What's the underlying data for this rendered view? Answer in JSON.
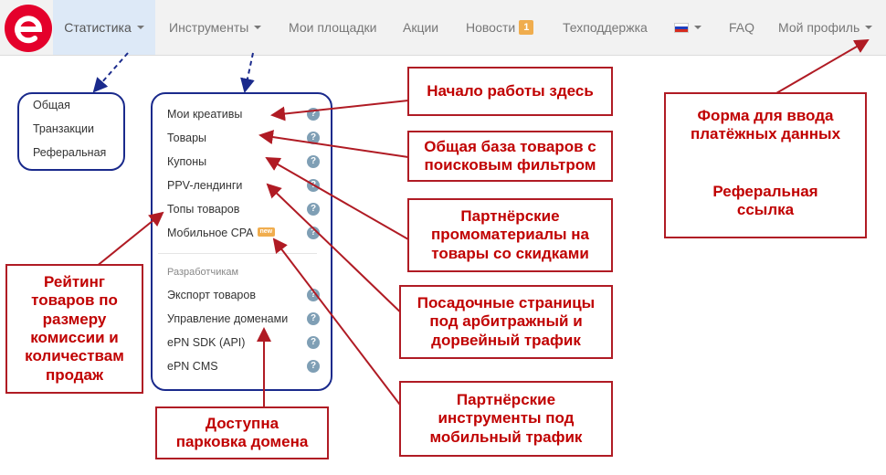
{
  "colors": {
    "callout_text": "#c00000",
    "callout_border": "#b01b24",
    "panel_border": "#1a2a8c",
    "logo": "#e4002b",
    "badge": "#f0ad4e",
    "nav_active_bg": "#dde9f7"
  },
  "navbar": {
    "logo_icon": "epn-logo-icon",
    "items": [
      {
        "label": "Статистика",
        "dropdown": true,
        "active": true
      },
      {
        "label": "Инструменты",
        "dropdown": true
      },
      {
        "label": "Мои площадки"
      },
      {
        "label": "Акции"
      },
      {
        "label": "Новости",
        "badge": "1"
      },
      {
        "label": "Техподдержка"
      },
      {
        "label": "",
        "icon": "russian-flag-icon",
        "dropdown": true
      },
      {
        "label": "FAQ"
      },
      {
        "label": "Мой профиль",
        "dropdown": true
      }
    ]
  },
  "stats_menu": {
    "items": [
      "Общая",
      "Транзакции",
      "Реферальная"
    ]
  },
  "tools_menu": {
    "items": [
      {
        "label": "Мои креативы",
        "help": "?"
      },
      {
        "label": "Товары",
        "help": "?"
      },
      {
        "label": "Купоны",
        "help": "?"
      },
      {
        "label": "PPV-лендинги",
        "help": "?"
      },
      {
        "label": "Топы товаров",
        "help": "?"
      },
      {
        "label": "Мобильное CPA",
        "badge": "new",
        "help": "?"
      }
    ],
    "dev_header": "Разработчикам",
    "dev_items": [
      {
        "label": "Экспорт товаров",
        "help": "?"
      },
      {
        "label": "Управление доменами",
        "help": "?"
      },
      {
        "label": "ePN SDK (API)",
        "help": "?"
      },
      {
        "label": "ePN CMS",
        "help": "?"
      }
    ]
  },
  "callouts": {
    "start_here": [
      "Начало работы здесь"
    ],
    "products_base": [
      "Общая база товаров с",
      "поисковым фильтром"
    ],
    "promo_materials": [
      "Партнёрские",
      "промоматериалы на",
      "товары со скидками"
    ],
    "landing_pages": [
      "Посадочные страницы",
      "под арбитражный и",
      "дорвейный трафик"
    ],
    "mobile_tools": [
      "Партнёрские",
      "инструменты под",
      "мобильный трафик"
    ],
    "domain_parking": [
      "Доступна",
      "парковка домена"
    ],
    "rating": [
      "Рейтинг",
      "товаров по",
      "размеру",
      "комиссии и",
      "количествам",
      "продаж"
    ],
    "payment_form": [
      "Форма для ввода",
      "платёжных данных"
    ],
    "referral_link": [
      "Реферальная",
      "ссылка"
    ]
  }
}
